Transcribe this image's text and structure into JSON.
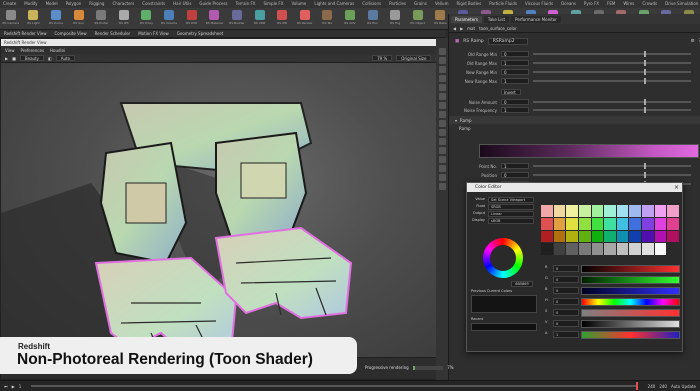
{
  "shelf": {
    "tabs": [
      "Create",
      "Modify",
      "Model",
      "Polygon",
      "Rigging",
      "Characters",
      "Constraints",
      "Hair Utils",
      "Guide Process",
      "Terrain FX",
      "Simple FX",
      "Volume",
      "Lights and Cameras",
      "Collisions",
      "Particles",
      "Grains",
      "Vellum",
      "Rigid Bodies",
      "Particle Fluids",
      "Viscous Fluids",
      "Oceans",
      "Pyro FX",
      "FEM",
      "Wires",
      "Crowds",
      "Drive Simulation",
      "Redshift"
    ],
    "active_tab": "Redshift",
    "tools": [
      {
        "label": "RS Camera",
        "color": "#8a8a8a"
      },
      {
        "label": "RS Light",
        "color": "#c9b45a"
      },
      {
        "label": "RS Dome",
        "color": "#5a8ec9"
      },
      {
        "label": "RS Sun",
        "color": "#d88a3a"
      },
      {
        "label": "RS Portal",
        "color": "#7a7a7a"
      },
      {
        "label": "RS IES",
        "color": "#aaaaaa"
      },
      {
        "label": "RS Proxy",
        "color": "#5fae6a"
      },
      {
        "label": "RS Volume",
        "color": "#4a7fb8"
      },
      {
        "label": "RS ROP",
        "color": "#c04040"
      },
      {
        "label": "RS Material",
        "color": "#b05ab0"
      },
      {
        "label": "RS Builder",
        "color": "#6a6a9a"
      },
      {
        "label": "RS VDB",
        "color": "#4aa0a0"
      },
      {
        "label": "RS IPR",
        "color": "#d05050"
      },
      {
        "label": "RS Render",
        "color": "#e06060"
      },
      {
        "label": "RS Tex",
        "color": "#8a6a4a"
      },
      {
        "label": "RS AOV",
        "color": "#6aa05a"
      },
      {
        "label": "RS Env",
        "color": "#5a7aa0"
      },
      {
        "label": "RS Fog",
        "color": "#9a9a9a"
      },
      {
        "label": "RS Object",
        "color": "#7a9a5a"
      },
      {
        "label": "RS Bake",
        "color": "#a07a4a"
      },
      {
        "label": "RS Help",
        "color": "#5a5a9a"
      },
      {
        "label": "RS Cam Tags",
        "color": "#8a5a8a"
      },
      {
        "label": "RS Lights",
        "color": "#c0b040"
      },
      {
        "label": "RS Toon",
        "color": "#5080c0"
      },
      {
        "label": "RS Outline",
        "color": "#d060d0"
      },
      {
        "label": "RS Sprite",
        "color": "#60a0a0"
      },
      {
        "label": "RS Mesh",
        "color": "#6a6a6a"
      },
      {
        "label": "RS Hair",
        "color": "#a06a6a"
      },
      {
        "label": "RS Points",
        "color": "#6aa06a"
      },
      {
        "label": "RS Lens",
        "color": "#6a6aa0"
      },
      {
        "label": "RS Settings",
        "color": "#8a8a4a"
      }
    ]
  },
  "panebar": {
    "tabs": [
      "Redshift Render View",
      "Composite View",
      "Render Scheduler",
      "Motion FX View",
      "Geometry Spreadsheet"
    ]
  },
  "render_view": {
    "window_title": "Redshift Render View",
    "menu": [
      "View",
      "Preferences",
      "Houdini"
    ],
    "toolbar": {
      "aov": "Beauty",
      "zoom": "79 %",
      "frame": "Original Size",
      "camera_label": "Auto"
    },
    "status": "Progressive rendering",
    "progress_percent": "7%"
  },
  "params": {
    "tabs": [
      "Parameters",
      "Take List",
      "Performance Monitor"
    ],
    "path": [
      "mat",
      "toon_surface_color"
    ],
    "node_type": "RS Ramp",
    "node_name": "RSRamp2",
    "rows": [
      {
        "label": "Old Range Min",
        "value": "0"
      },
      {
        "label": "Old Range Max",
        "value": "1"
      },
      {
        "label": "New Range Min",
        "value": "0"
      },
      {
        "label": "New Range Max",
        "value": "1"
      }
    ],
    "invert_label": "Invert",
    "rows2": [
      {
        "label": "Noise Amount",
        "value": "0"
      },
      {
        "label": "Noise Frequency",
        "value": "1"
      }
    ],
    "ramp_section": "Ramp",
    "ramp_label": "Ramp",
    "ramp_rows": [
      {
        "label": "Point No.",
        "value": "1"
      },
      {
        "label": "Position",
        "value": "0"
      },
      {
        "label": "Color",
        "value": "0"
      }
    ],
    "interpolation_label": "Interpolation",
    "interpolation_value": "Linear"
  },
  "color_editor": {
    "title": "Color Editor",
    "fields": [
      {
        "label": "Value",
        "value": "Set Scene Viewport"
      },
      {
        "label": "Float",
        "value": "SRGB"
      },
      {
        "label": "Output",
        "value": "Linear"
      },
      {
        "label": "Display",
        "value": "sRGB"
      }
    ],
    "hex": "6B5869",
    "prev_label": "Previous Current Colors",
    "recent_label": "Recent",
    "swatch_colors": [
      "#f0a8a8",
      "#f0d8a0",
      "#f0f0a0",
      "#c8f0a0",
      "#a0f0a0",
      "#a0f0d8",
      "#a0e0f0",
      "#a0b8f0",
      "#c0a0f0",
      "#f0a0f0",
      "#f0a0c8",
      "#e05050",
      "#e0a040",
      "#e0e040",
      "#90e040",
      "#40e040",
      "#40e0a0",
      "#40c0e0",
      "#4070e0",
      "#8040e0",
      "#e040e0",
      "#e04090",
      "#b02020",
      "#b07010",
      "#b0b010",
      "#60b010",
      "#10b010",
      "#10b070",
      "#1090b0",
      "#1040b0",
      "#5010b0",
      "#b010b0",
      "#b01060",
      "#202020",
      "#404040",
      "#606060",
      "#7a7a7a",
      "#909090",
      "#a8a8a8",
      "#c0c0c0",
      "#d0d0d0",
      "#e0e0e0",
      "#f8f8f8"
    ],
    "bars": [
      {
        "label": "R",
        "value": "0",
        "gradient": "linear-gradient(90deg,#000,#ff3030)"
      },
      {
        "label": "G",
        "value": "0",
        "gradient": "linear-gradient(90deg,#002000,#30ff30)"
      },
      {
        "label": "B",
        "value": "0",
        "gradient": "linear-gradient(90deg,#000020,#3030ff)"
      },
      {
        "label": "H",
        "value": "0",
        "gradient": "linear-gradient(90deg,red,#ff0,lime,cyan,blue,magenta,red)"
      },
      {
        "label": "S",
        "value": "0",
        "gradient": "linear-gradient(90deg,#808080,#ff3030)"
      },
      {
        "label": "V",
        "value": "0",
        "gradient": "linear-gradient(90deg,#000,#e0e0e0)"
      },
      {
        "label": "A",
        "value": "1",
        "gradient": "linear-gradient(90deg,#30a030,#ff3030,#2020c0)"
      }
    ]
  },
  "caption": {
    "line1": "Redshift",
    "line2": "Non-Photoreal Rendering (Toon Shader)"
  },
  "timeline": {
    "start": "1",
    "end": "240",
    "current": "240",
    "play_label": "Auto Update"
  }
}
